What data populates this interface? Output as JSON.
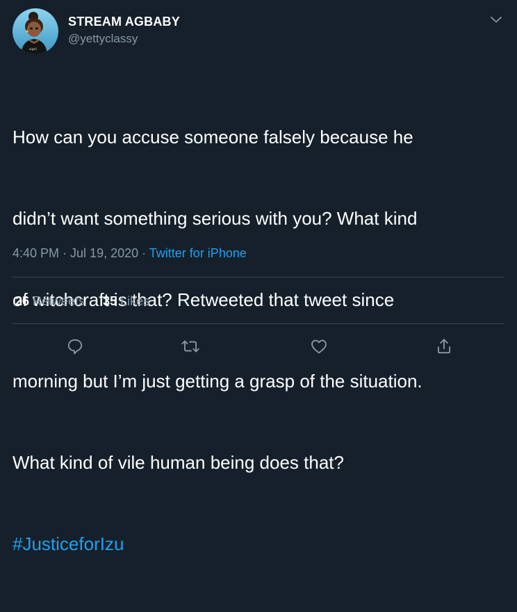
{
  "author": {
    "display_name": "STREAM AGBABY",
    "handle": "@yettyclassy"
  },
  "tweet": {
    "lines": [
      "How can you accuse someone falsely because he",
      "didn’t want something serious with you? What kind",
      "of witchcraft is that? Retweeted that tweet since",
      "morning but I’m just getting a grasp of the situation.",
      "What kind of vile human being does that?"
    ],
    "hashtag": "#JusticeforIzu"
  },
  "meta": {
    "time": "4:40 PM",
    "sep1": " · ",
    "date": "Jul 19, 2020",
    "sep2": " · ",
    "source": "Twitter for iPhone"
  },
  "stats": {
    "retweets_count": "26",
    "retweets_label": "Retweets",
    "likes_count": "35",
    "likes_label": "Likes"
  },
  "icons": {
    "reply": "reply-icon",
    "retweet": "retweet-icon",
    "like": "heart-icon",
    "share": "share-icon",
    "caret": "chevron-down-icon"
  },
  "colors": {
    "background": "#15202b",
    "text": "#ffffff",
    "secondary": "#8899a6",
    "link": "#1da1f2",
    "divider": "#38444d"
  }
}
